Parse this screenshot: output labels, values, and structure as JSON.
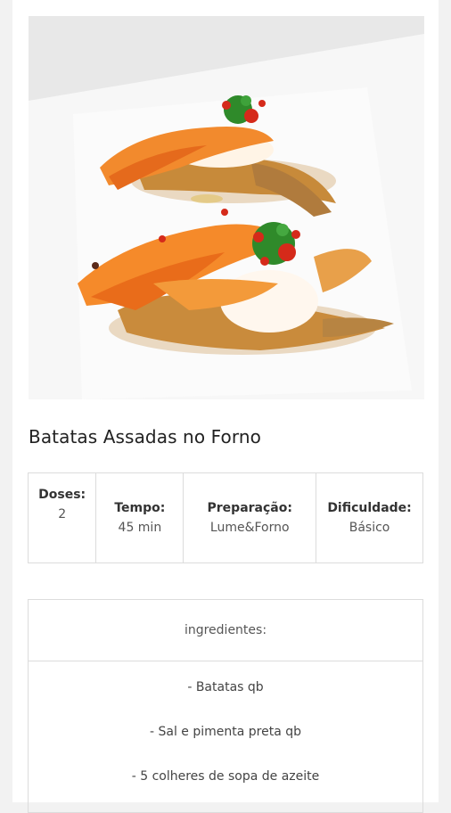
{
  "recipe": {
    "title": "Batatas Assadas no Forno"
  },
  "info": {
    "doses_label": "Doses:",
    "doses_value": "2",
    "tempo_label": "Tempo:",
    "tempo_value": "45 min",
    "prep_label": "Preparação:",
    "prep_value": "Lume&Forno",
    "dif_label": "Dificuldade:",
    "dif_value": "Básico"
  },
  "ingredients": {
    "heading": "ingredientes:",
    "items": [
      "- Batatas qb",
      "- Sal e pimenta preta qb",
      "- 5 colheres de sopa de azeite"
    ]
  },
  "colors": {
    "accent": "#ff7a2a",
    "text": "#222222",
    "border": "#dcdcdc"
  }
}
